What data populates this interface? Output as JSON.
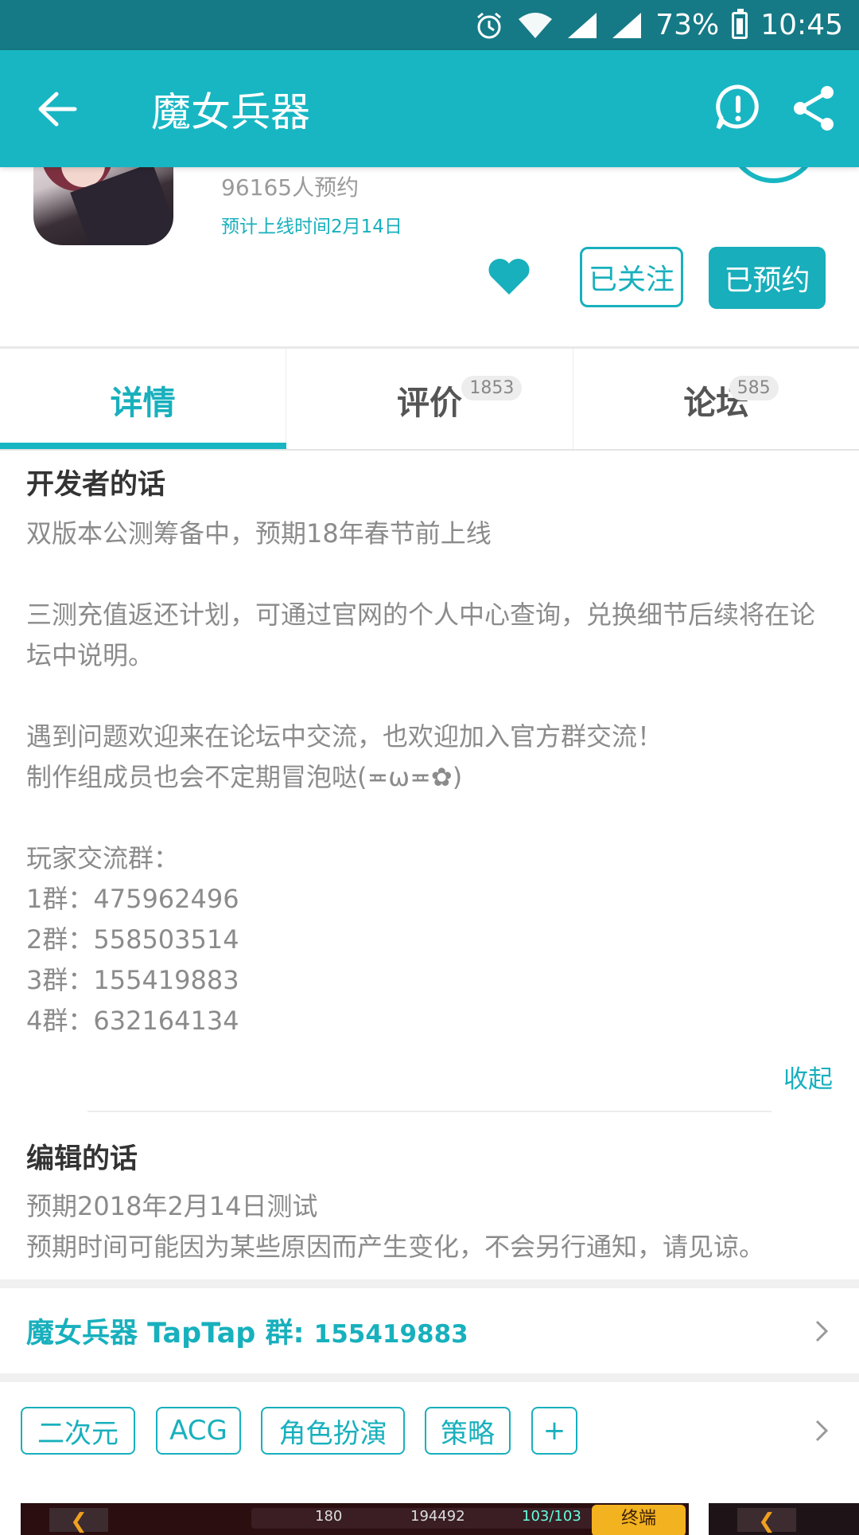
{
  "status_bar": {
    "battery": "73%",
    "time": "10:45",
    "icons": [
      "alarm-icon",
      "wifi-icon",
      "signal-icon",
      "signal-icon",
      "battery-icon"
    ]
  },
  "app_bar": {
    "title": "魔女兵器",
    "background": "#18b6c3"
  },
  "game": {
    "reservations": "96165人预约",
    "release_date": "预计上线时间2月14日",
    "follow_label": "已关注",
    "reserve_label": "已预约",
    "accent_color": "#18b0bd"
  },
  "tabs": [
    {
      "label": "详情",
      "badge": "",
      "active": true
    },
    {
      "label": "评价",
      "badge": "1853",
      "active": false
    },
    {
      "label": "论坛",
      "badge": "585",
      "active": false
    }
  ],
  "developer": {
    "title": "开发者的话",
    "lines": [
      "双版本公测筹备中，预期18年春节前上线",
      "",
      "三测充值返还计划，可通过官网的个人中心查询，兑换细节后续将在论坛中说明。",
      "",
      "遇到问题欢迎来在论坛中交流，也欢迎加入官方群交流！",
      "制作组成员也会不定期冒泡哒(≖ω≖✿)",
      "",
      "玩家交流群：",
      "1群：475962496",
      "2群：558503514",
      "3群：155419883",
      "4群：632164134"
    ],
    "collapse_label": "收起"
  },
  "editor": {
    "title": "编辑的话",
    "lines": [
      "预期2018年2月14日测试",
      "预期时间可能因为某些原因而产生变化，不会另行通知，请见谅。"
    ]
  },
  "group": {
    "label": "魔女兵器 TapTap 群:",
    "number": "155419883"
  },
  "tags": [
    "二次元",
    "ACG",
    "角色扮演",
    "策略",
    "+"
  ],
  "screenshot_preview": {
    "hud_values": [
      "180",
      "194492",
      "103/103"
    ],
    "terminal_label": "终端"
  }
}
